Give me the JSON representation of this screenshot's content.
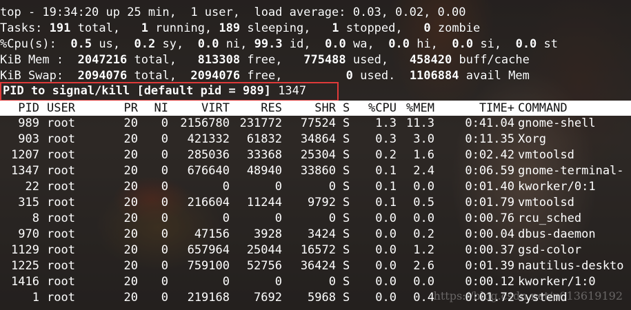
{
  "summary": {
    "line1": "top - 19:34:20 up 25 min,  1 user,  load average: 0.03, 0.02, 0.00",
    "tasks": {
      "label": "Tasks:",
      "total": "191",
      "total_txt": "total,",
      "running": "1",
      "running_txt": "running,",
      "sleeping": "189",
      "sleeping_txt": "sleeping,",
      "stopped": "1",
      "stopped_txt": "stopped,",
      "zombie": "0",
      "zombie_txt": "zombie"
    },
    "cpu": {
      "label": "%Cpu(s):",
      "us": "0.5",
      "us_txt": "us,",
      "sy": "0.2",
      "sy_txt": "sy,",
      "ni": "0.0",
      "ni_txt": "ni,",
      "id": "99.3",
      "id_txt": "id,",
      "wa": "0.0",
      "wa_txt": "wa,",
      "hi": "0.0",
      "hi_txt": "hi,",
      "si": "0.0",
      "si_txt": "si,",
      "st": "0.0",
      "st_txt": "st"
    },
    "mem": {
      "label": "KiB Mem :",
      "total": "2047216",
      "total_txt": "total,",
      "free": "813308",
      "free_txt": "free,",
      "used": "775488",
      "used_txt": "used,",
      "buff": "458420",
      "buff_txt": "buff/cache"
    },
    "swap": {
      "label": "KiB Swap:",
      "total": "2094076",
      "total_txt": "total,",
      "free": "2094076",
      "free_txt": "free,",
      "used": "0",
      "used_txt": "used.",
      "avail": "1106884",
      "avail_txt": "avail Mem"
    }
  },
  "prompt": {
    "label": "PID to signal/kill [default pid = 989]",
    "input": "1347"
  },
  "columns": [
    "PID",
    "USER",
    "PR",
    "NI",
    "VIRT",
    "RES",
    "SHR",
    "S",
    "%CPU",
    "%MEM",
    "TIME+",
    "COMMAND"
  ],
  "processes": [
    {
      "pid": "989",
      "user": "root",
      "pr": "20",
      "ni": "0",
      "virt": "2156780",
      "res": "231772",
      "shr": "77524",
      "s": "S",
      "cpu": "1.3",
      "mem": "11.3",
      "time": "0:41.04",
      "cmd": "gnome-shell"
    },
    {
      "pid": "903",
      "user": "root",
      "pr": "20",
      "ni": "0",
      "virt": "421332",
      "res": "61832",
      "shr": "34864",
      "s": "S",
      "cpu": "0.3",
      "mem": "3.0",
      "time": "0:11.35",
      "cmd": "Xorg"
    },
    {
      "pid": "1207",
      "user": "root",
      "pr": "20",
      "ni": "0",
      "virt": "285036",
      "res": "33368",
      "shr": "25304",
      "s": "S",
      "cpu": "0.2",
      "mem": "1.6",
      "time": "0:02.42",
      "cmd": "vmtoolsd"
    },
    {
      "pid": "1347",
      "user": "root",
      "pr": "20",
      "ni": "0",
      "virt": "676640",
      "res": "48940",
      "shr": "33860",
      "s": "S",
      "cpu": "0.1",
      "mem": "2.4",
      "time": "0:06.59",
      "cmd": "gnome-terminal-"
    },
    {
      "pid": "22",
      "user": "root",
      "pr": "20",
      "ni": "0",
      "virt": "0",
      "res": "0",
      "shr": "0",
      "s": "S",
      "cpu": "0.1",
      "mem": "0.0",
      "time": "0:01.40",
      "cmd": "kworker/0:1"
    },
    {
      "pid": "315",
      "user": "root",
      "pr": "20",
      "ni": "0",
      "virt": "216604",
      "res": "11244",
      "shr": "9792",
      "s": "S",
      "cpu": "0.1",
      "mem": "0.5",
      "time": "0:01.79",
      "cmd": "vmtoolsd"
    },
    {
      "pid": "8",
      "user": "root",
      "pr": "20",
      "ni": "0",
      "virt": "0",
      "res": "0",
      "shr": "0",
      "s": "S",
      "cpu": "0.0",
      "mem": "0.0",
      "time": "0:00.76",
      "cmd": "rcu_sched"
    },
    {
      "pid": "970",
      "user": "root",
      "pr": "20",
      "ni": "0",
      "virt": "47156",
      "res": "3928",
      "shr": "3424",
      "s": "S",
      "cpu": "0.0",
      "mem": "0.2",
      "time": "0:00.04",
      "cmd": "dbus-daemon"
    },
    {
      "pid": "1129",
      "user": "root",
      "pr": "20",
      "ni": "0",
      "virt": "657964",
      "res": "25044",
      "shr": "16572",
      "s": "S",
      "cpu": "0.0",
      "mem": "1.2",
      "time": "0:00.37",
      "cmd": "gsd-color"
    },
    {
      "pid": "1225",
      "user": "root",
      "pr": "20",
      "ni": "0",
      "virt": "759100",
      "res": "52756",
      "shr": "36424",
      "s": "S",
      "cpu": "0.0",
      "mem": "2.6",
      "time": "0:01.39",
      "cmd": "nautilus-deskto"
    },
    {
      "pid": "1416",
      "user": "root",
      "pr": "20",
      "ni": "0",
      "virt": "0",
      "res": "0",
      "shr": "0",
      "s": "S",
      "cpu": "0.0",
      "mem": "0.0",
      "time": "0:00.12",
      "cmd": "kworker/1:0"
    },
    {
      "pid": "1",
      "user": "root",
      "pr": "20",
      "ni": "0",
      "virt": "219168",
      "res": "7692",
      "shr": "5968",
      "s": "S",
      "cpu": "0.0",
      "mem": "0.4",
      "time": "0:01.72",
      "cmd": "systemd"
    }
  ],
  "watermark": "https://blog.csdn.net/u013619192",
  "colors": {
    "highlight_border": "#e03a3a",
    "header_bg": "#ffffff",
    "text": "#ffffff"
  }
}
